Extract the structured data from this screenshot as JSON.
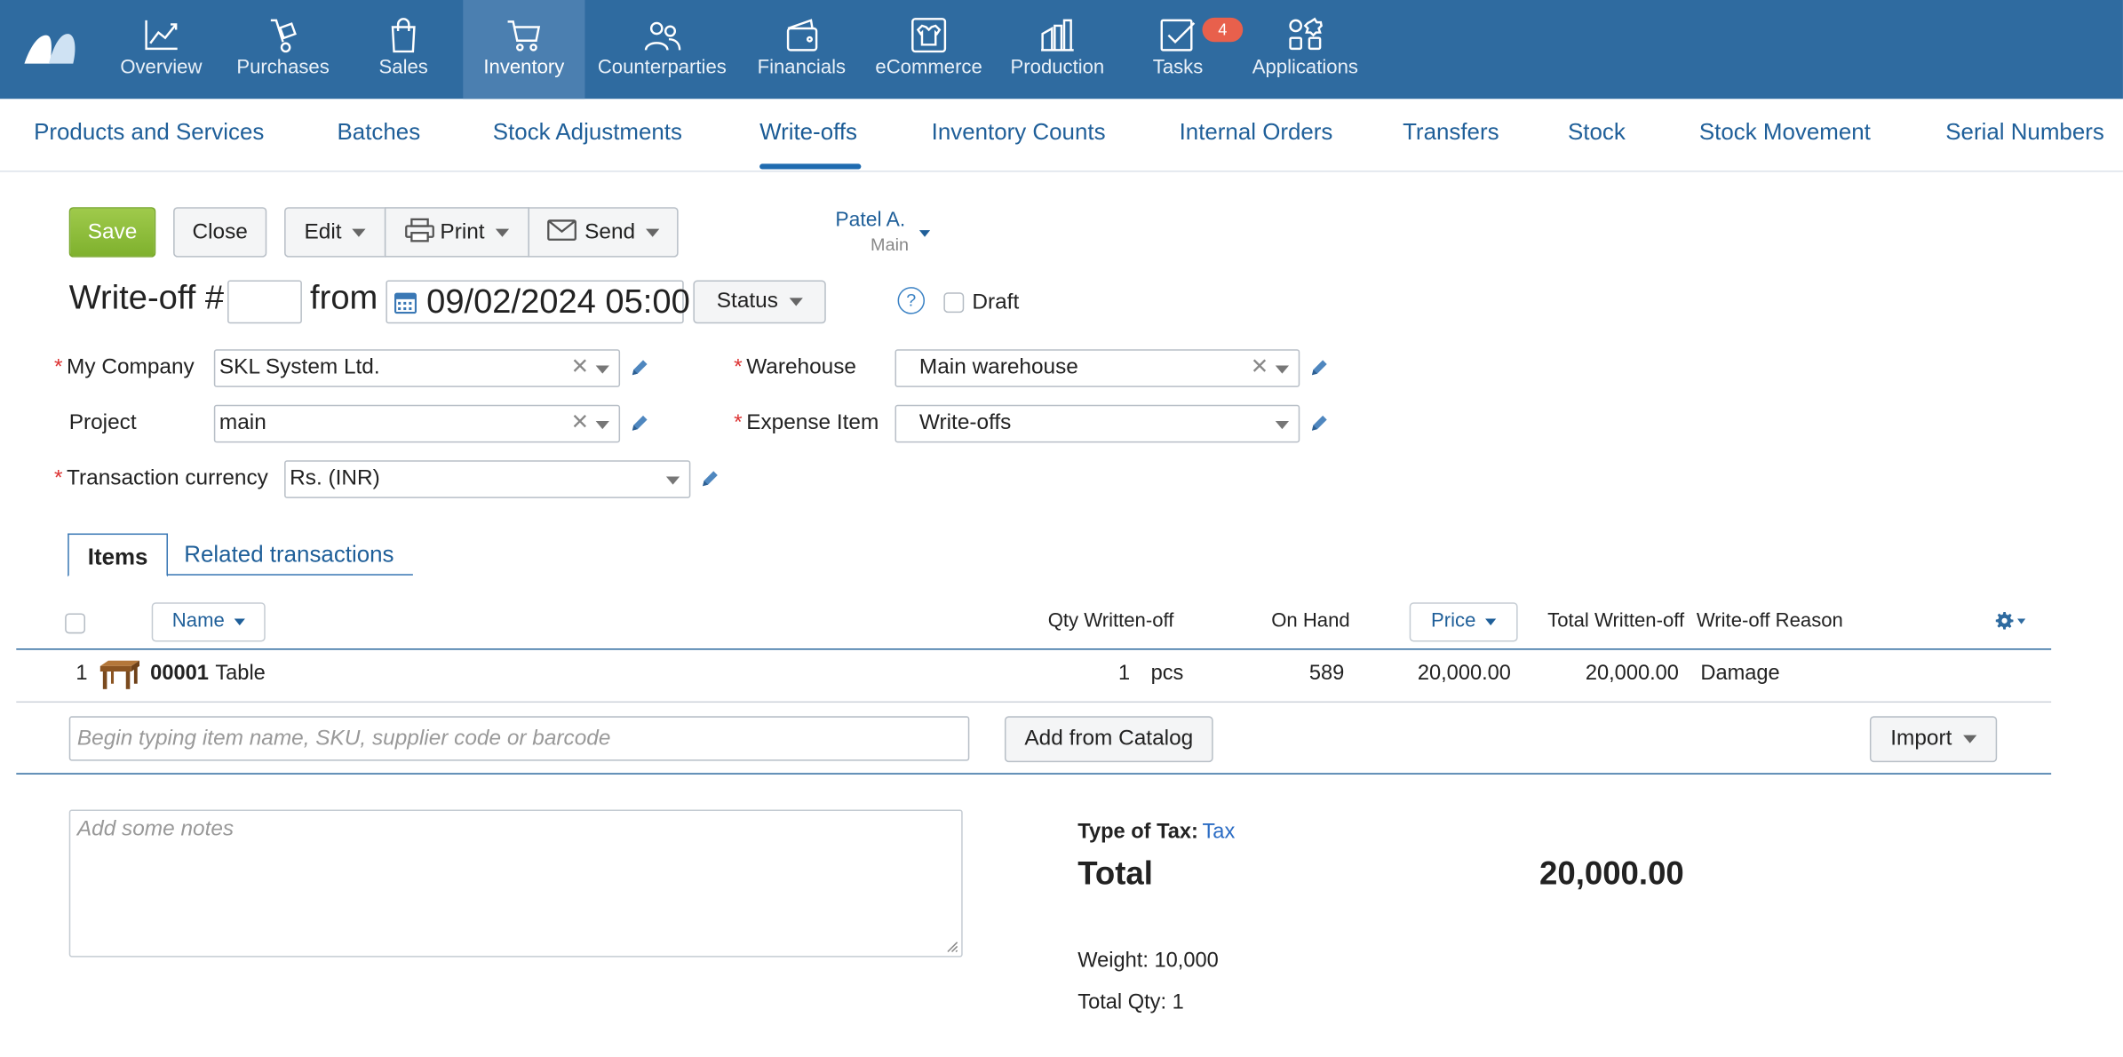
{
  "nav": {
    "items": [
      {
        "label": "Overview",
        "icon": "chart-line-icon"
      },
      {
        "label": "Purchases",
        "icon": "hand-truck-icon"
      },
      {
        "label": "Sales",
        "icon": "shopping-bag-icon"
      },
      {
        "label": "Inventory",
        "icon": "cart-icon"
      },
      {
        "label": "Counterparties",
        "icon": "people-icon"
      },
      {
        "label": "Financials",
        "icon": "wallet-icon"
      },
      {
        "label": "eCommerce",
        "icon": "shirt-icon"
      },
      {
        "label": "Production",
        "icon": "factory-icon"
      },
      {
        "label": "Tasks",
        "icon": "task-check-icon",
        "badge": "4"
      },
      {
        "label": "Applications",
        "icon": "apps-grid-icon"
      }
    ],
    "active": "Inventory"
  },
  "subnav": {
    "items": [
      "Products and Services",
      "Batches",
      "Stock Adjustments",
      "Write-offs",
      "Inventory Counts",
      "Internal Orders",
      "Transfers",
      "Stock",
      "Stock Movement",
      "Serial Numbers"
    ],
    "active": "Write-offs"
  },
  "toolbar": {
    "save": "Save",
    "close": "Close",
    "edit": "Edit",
    "print": "Print",
    "send": "Send",
    "owner": "Patel A.",
    "owner_group": "Main"
  },
  "doc": {
    "title": "Write-off #",
    "number": "",
    "from_label": "from",
    "date": "09/02/2024 05:00",
    "status": "Status",
    "help": "?",
    "draft_label": "Draft",
    "draft_checked": false
  },
  "form": {
    "company_label": "My Company",
    "company": "SKL System Ltd.",
    "project_label": "Project",
    "project": "main",
    "currency_label": "Transaction currency",
    "currency": "Rs. (INR)",
    "warehouse_label": "Warehouse",
    "warehouse": "Main warehouse",
    "expense_label": "Expense Item",
    "expense": "Write-offs",
    "required_mark": "*"
  },
  "tabs": {
    "items": "Items",
    "related": "Related transactions"
  },
  "grid": {
    "headers": {
      "name": "Name",
      "qty": "Qty Written-off",
      "onhand": "On Hand",
      "price": "Price",
      "total": "Total Written-off",
      "reason": "Write-off Reason"
    },
    "rows": [
      {
        "num": "1",
        "code": "00001",
        "name": "Table",
        "qty": "1",
        "unit": "pcs",
        "onhand": "589",
        "price": "20,000.00",
        "total": "20,000.00",
        "reason": "Damage"
      }
    ],
    "item_placeholder": "Begin typing item name, SKU, supplier code or barcode",
    "add_catalog": "Add from Catalog",
    "import": "Import"
  },
  "footer": {
    "notes_placeholder": "Add some notes",
    "tax_label": "Type of Tax:",
    "tax_value": "Tax",
    "total_label": "Total",
    "total_value": "20,000.00",
    "weight": "Weight: 10,000",
    "total_qty": "Total Qty: 1"
  },
  "colors": {
    "topbar": "#2f6ba0",
    "topbar_active": "#4b7fb0",
    "link": "#1f5f99",
    "save_green": "#8cbd3a",
    "badge": "#e8604c",
    "required": "#dd3333"
  }
}
